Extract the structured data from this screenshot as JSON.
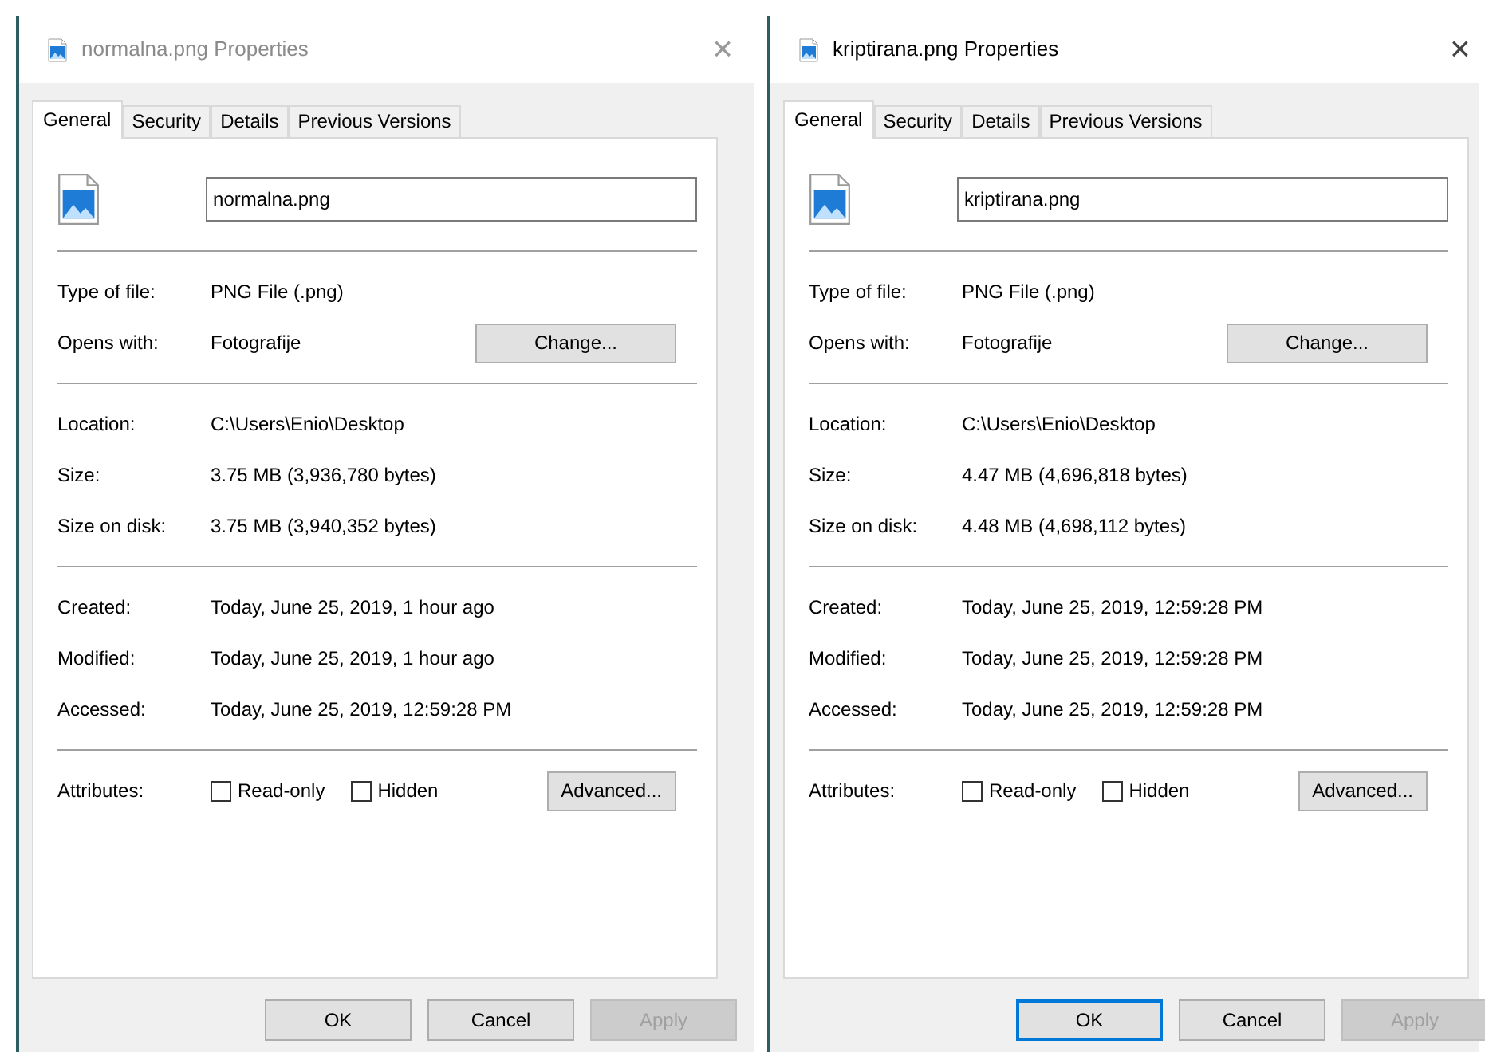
{
  "windows": [
    {
      "title": "normalna.png Properties",
      "active": false,
      "close": "×",
      "tabs": [
        {
          "label": "General",
          "selected": true
        },
        {
          "label": "Security",
          "selected": false
        },
        {
          "label": "Details",
          "selected": false
        },
        {
          "label": "Previous Versions",
          "selected": false
        }
      ],
      "file_name": "normalna.png",
      "sections": [
        [
          {
            "kind": "text",
            "label": "Type of file:",
            "value": "PNG File (.png)"
          },
          {
            "kind": "button",
            "label": "Opens with:",
            "value": "Fotografije",
            "button": "Change..."
          }
        ],
        [
          {
            "kind": "text",
            "label": "Location:",
            "value": "C:\\Users\\Enio\\Desktop"
          },
          {
            "kind": "text",
            "label": "Size:",
            "value": "3.75 MB (3,936,780 bytes)"
          },
          {
            "kind": "text",
            "label": "Size on disk:",
            "value": "3.75 MB (3,940,352 bytes)"
          }
        ],
        [
          {
            "kind": "text",
            "label": "Created:",
            "value": "Today, June 25, 2019, 1 hour ago"
          },
          {
            "kind": "text",
            "label": "Modified:",
            "value": "Today, June 25, 2019, 1 hour ago"
          },
          {
            "kind": "text",
            "label": "Accessed:",
            "value": "Today, June 25, 2019, 12:59:28 PM"
          }
        ]
      ],
      "attributes": {
        "label": "Attributes:",
        "checkboxes": [
          {
            "label": "Read-only",
            "checked": false
          },
          {
            "label": "Hidden",
            "checked": false
          }
        ],
        "button": "Advanced..."
      },
      "buttons": [
        {
          "label": "OK",
          "disabled": false,
          "focused": false
        },
        {
          "label": "Cancel",
          "disabled": false,
          "focused": false
        },
        {
          "label": "Apply",
          "disabled": true,
          "focused": false
        }
      ]
    },
    {
      "title": "kriptirana.png Properties",
      "active": true,
      "close": "×",
      "tabs": [
        {
          "label": "General",
          "selected": true
        },
        {
          "label": "Security",
          "selected": false
        },
        {
          "label": "Details",
          "selected": false
        },
        {
          "label": "Previous Versions",
          "selected": false
        }
      ],
      "file_name": "kriptirana.png",
      "sections": [
        [
          {
            "kind": "text",
            "label": "Type of file:",
            "value": "PNG File (.png)"
          },
          {
            "kind": "button",
            "label": "Opens with:",
            "value": "Fotografije",
            "button": "Change..."
          }
        ],
        [
          {
            "kind": "text",
            "label": "Location:",
            "value": "C:\\Users\\Enio\\Desktop"
          },
          {
            "kind": "text",
            "label": "Size:",
            "value": "4.47 MB (4,696,818 bytes)"
          },
          {
            "kind": "text",
            "label": "Size on disk:",
            "value": "4.48 MB (4,698,112 bytes)"
          }
        ],
        [
          {
            "kind": "text",
            "label": "Created:",
            "value": "Today, June 25, 2019, 12:59:28 PM"
          },
          {
            "kind": "text",
            "label": "Modified:",
            "value": "Today, June 25, 2019, 12:59:28 PM"
          },
          {
            "kind": "text",
            "label": "Accessed:",
            "value": "Today, June 25, 2019, 12:59:28 PM"
          }
        ]
      ],
      "attributes": {
        "label": "Attributes:",
        "checkboxes": [
          {
            "label": "Read-only",
            "checked": false
          },
          {
            "label": "Hidden",
            "checked": false
          }
        ],
        "button": "Advanced..."
      },
      "buttons": [
        {
          "label": "OK",
          "disabled": false,
          "focused": true
        },
        {
          "label": "Cancel",
          "disabled": false,
          "focused": false
        },
        {
          "label": "Apply",
          "disabled": true,
          "focused": false
        }
      ]
    }
  ]
}
